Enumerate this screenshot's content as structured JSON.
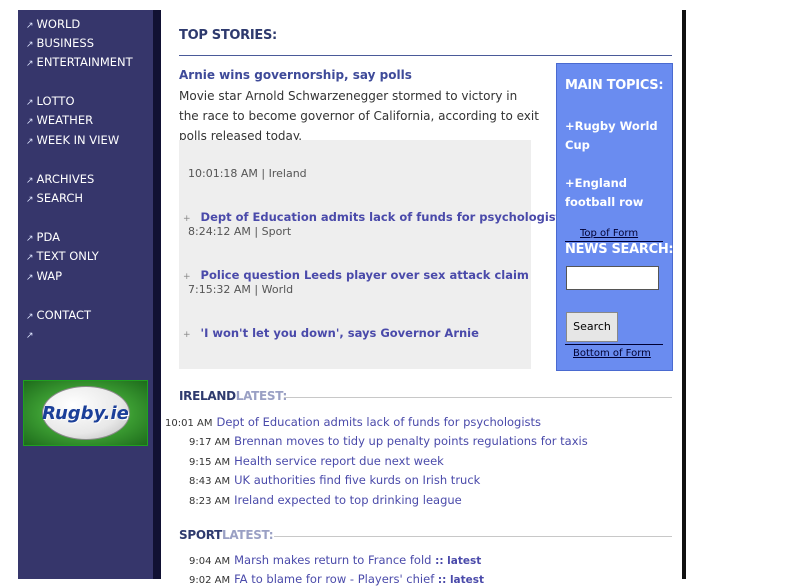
{
  "sidebar": {
    "nav_groups": [
      [
        "WORLD",
        "BUSINESS",
        "ENTERTAINMENT"
      ],
      [
        "LOTTO",
        "WEATHER",
        "WEEK IN VIEW"
      ],
      [
        "ARCHIVES",
        "SEARCH"
      ],
      [
        "PDA",
        "TEXT ONLY",
        "WAP"
      ],
      [
        "CONTACT",
        ""
      ]
    ],
    "nav_arrow": "↗",
    "banner_text": "Rugby.ie"
  },
  "top_stories": {
    "title": "TOP STORIES:",
    "lead": {
      "headline": "Arnie wins governorship, say polls",
      "summary": "Movie star Arnold Schwarzenegger stormed to victory in the race to become governor of California, according to exit polls released today.",
      "time": "10:01:18 AM | Ireland"
    },
    "stories": [
      {
        "link": "Dept of Education admits lack of funds for psychologists",
        "time": "8:24:12 AM | Sport"
      },
      {
        "link": "Police question Leeds player over sex attack claim",
        "time": "7:15:32 AM | World"
      },
      {
        "link": "'I won't let you down', says Governor Arnie",
        "time": ""
      }
    ],
    "bullet": "+"
  },
  "main_topics": {
    "title": "MAIN TOPICS:",
    "topics": [
      "+Rugby World Cup",
      "+England football row"
    ],
    "top_of_form": "Top of Form",
    "news_search_title": "NEWS SEARCH:",
    "search_placeholder": "",
    "search_button": "Search",
    "bottom_of_form": "Bottom of Form"
  },
  "ireland": {
    "title_bold": "IRELAND",
    "title_light": "LATEST:",
    "items": [
      {
        "time": "10:01 AM",
        "text": "Dept of Education admits lack of funds for psychologists"
      },
      {
        "time": "9:17 AM",
        "text": "Brennan moves to tidy up penalty points regulations for taxis"
      },
      {
        "time": "9:15 AM",
        "text": "Health service report due next week"
      },
      {
        "time": "8:43 AM",
        "text": "UK authorities find five kurds on Irish truck"
      },
      {
        "time": "8:23 AM",
        "text": "Ireland expected to top drinking league"
      }
    ]
  },
  "sport": {
    "title_bold": "SPORT",
    "title_light": "LATEST:",
    "items": [
      {
        "time": "9:04 AM",
        "text": "Marsh makes return to France fold",
        "extra": ":: latest"
      },
      {
        "time": "9:02 AM",
        "text": "FA to blame for row - Players' chief",
        "extra": ":: latest"
      }
    ]
  },
  "colors": {
    "sidebar_bg": "#36366b",
    "topics_bg": "#6a8cf0",
    "link": "#4a4aaa",
    "heading": "#2e3a6e"
  }
}
